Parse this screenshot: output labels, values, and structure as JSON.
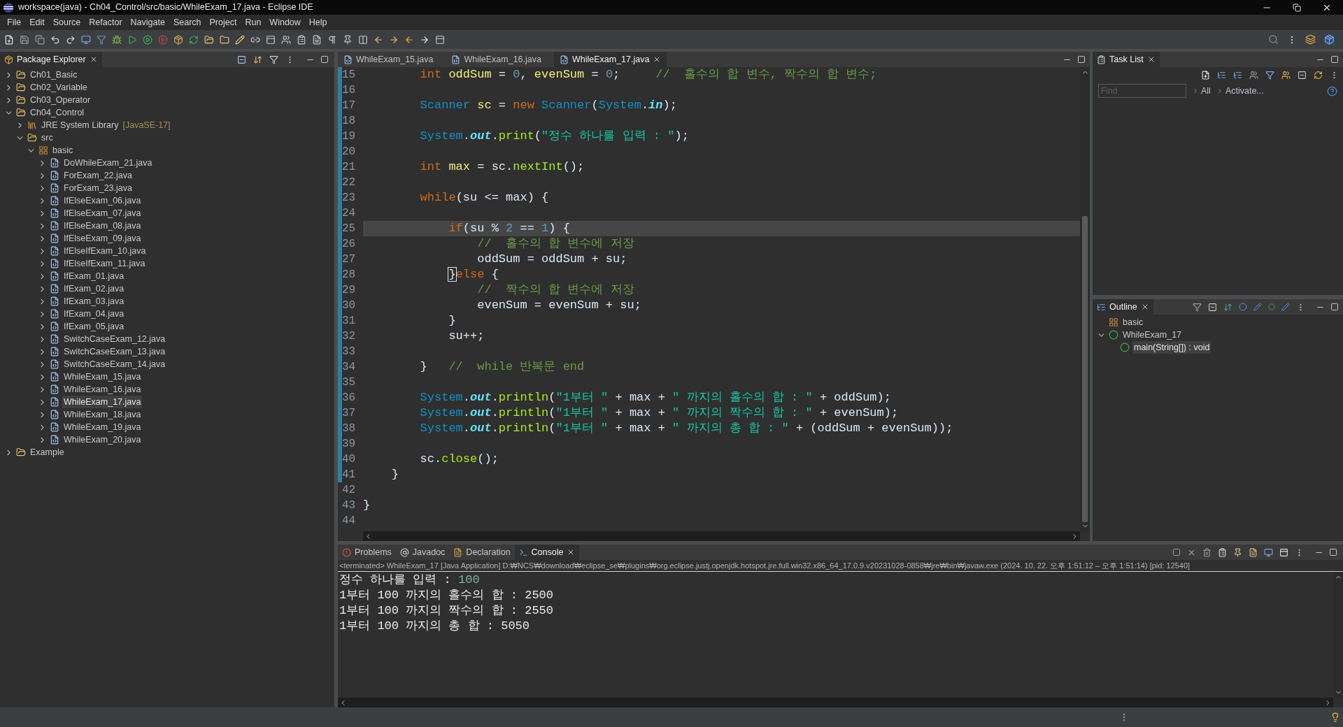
{
  "window": {
    "title": "workspace(java) - Ch04_Control/src/basic/WhileExam_17.java - Eclipse IDE"
  },
  "menu": [
    "File",
    "Edit",
    "Source",
    "Refactor",
    "Navigate",
    "Search",
    "Project",
    "Run",
    "Window",
    "Help"
  ],
  "explorer": {
    "title": "Package Explorer",
    "tree": [
      {
        "kind": "project",
        "label": "Ch01_Basic",
        "expanded": false,
        "selected": false
      },
      {
        "kind": "project",
        "label": "Ch02_Variable",
        "expanded": false,
        "selected": false
      },
      {
        "kind": "project",
        "label": "Ch03_Operator",
        "expanded": false,
        "selected": false
      },
      {
        "kind": "project",
        "label": "Ch04_Control",
        "expanded": true,
        "selected": false,
        "children": [
          {
            "kind": "library",
            "label": "JRE System Library",
            "decoration": "[JavaSE-17]",
            "expanded": false,
            "selected": false
          },
          {
            "kind": "folder",
            "label": "src",
            "expanded": true,
            "selected": false,
            "children": [
              {
                "kind": "package",
                "label": "basic",
                "expanded": true,
                "selected": false,
                "children": [
                  {
                    "kind": "file",
                    "label": "DoWhileExam_21.java",
                    "expanded": false,
                    "selected": false
                  },
                  {
                    "kind": "file",
                    "label": "ForExam_22.java",
                    "expanded": false,
                    "selected": false
                  },
                  {
                    "kind": "file",
                    "label": "ForExam_23.java",
                    "expanded": false,
                    "selected": false
                  },
                  {
                    "kind": "file",
                    "label": "IfElseExam_06.java",
                    "expanded": false,
                    "selected": false
                  },
                  {
                    "kind": "file",
                    "label": "IfElseExam_07.java",
                    "expanded": false,
                    "selected": false
                  },
                  {
                    "kind": "file",
                    "label": "IfElseExam_08.java",
                    "expanded": false,
                    "selected": false
                  },
                  {
                    "kind": "file",
                    "label": "IfElseExam_09.java",
                    "expanded": false,
                    "selected": false
                  },
                  {
                    "kind": "file",
                    "label": "IfElseIfExam_10.java",
                    "expanded": false,
                    "selected": false
                  },
                  {
                    "kind": "file",
                    "label": "IfElseIfExam_11.java",
                    "expanded": false,
                    "selected": false
                  },
                  {
                    "kind": "file",
                    "label": "IfExam_01.java",
                    "expanded": false,
                    "selected": false
                  },
                  {
                    "kind": "file",
                    "label": "IfExam_02.java",
                    "expanded": false,
                    "selected": false
                  },
                  {
                    "kind": "file",
                    "label": "IfExam_03.java",
                    "expanded": false,
                    "selected": false
                  },
                  {
                    "kind": "file",
                    "label": "IfExam_04.java",
                    "expanded": false,
                    "selected": false
                  },
                  {
                    "kind": "file",
                    "label": "IfExam_05.java",
                    "expanded": false,
                    "selected": false
                  },
                  {
                    "kind": "file",
                    "label": "SwitchCaseExam_12.java",
                    "expanded": false,
                    "selected": false
                  },
                  {
                    "kind": "file",
                    "label": "SwitchCaseExam_13.java",
                    "expanded": false,
                    "selected": false
                  },
                  {
                    "kind": "file",
                    "label": "SwitchCaseExam_14.java",
                    "expanded": false,
                    "selected": false
                  },
                  {
                    "kind": "file",
                    "label": "WhileExam_15.java",
                    "expanded": false,
                    "selected": false
                  },
                  {
                    "kind": "file",
                    "label": "WhileExam_16.java",
                    "expanded": false,
                    "selected": false
                  },
                  {
                    "kind": "file",
                    "label": "WhileExam_17.java",
                    "expanded": false,
                    "selected": true
                  },
                  {
                    "kind": "file",
                    "label": "WhileExam_18.java",
                    "expanded": false,
                    "selected": false
                  },
                  {
                    "kind": "file",
                    "label": "WhileExam_19.java",
                    "expanded": false,
                    "selected": false
                  },
                  {
                    "kind": "file",
                    "label": "WhileExam_20.java",
                    "expanded": false,
                    "selected": false
                  }
                ]
              }
            ]
          }
        ]
      },
      {
        "kind": "project",
        "label": "Example",
        "expanded": false,
        "selected": false
      }
    ]
  },
  "editor": {
    "tabs": [
      {
        "label": "WhileExam_15.java",
        "selected": false
      },
      {
        "label": "WhileExam_16.java",
        "selected": false
      },
      {
        "label": "WhileExam_17.java",
        "selected": true
      }
    ],
    "lines": [
      {
        "number": "15",
        "current": false,
        "changed": true,
        "tokens": [
          {
            "kind": "keyword",
            "text": "        int"
          },
          {
            "kind": "variable",
            "text": " oddSum"
          },
          {
            "kind": "plain",
            "text": " = "
          },
          {
            "kind": "number",
            "text": "0"
          },
          {
            "kind": "plain",
            "text": ", "
          },
          {
            "kind": "variable",
            "text": "evenSum"
          },
          {
            "kind": "plain",
            "text": " = "
          },
          {
            "kind": "number",
            "text": "0"
          },
          {
            "kind": "plain",
            "text": ";     "
          },
          {
            "kind": "comment",
            "text": "//  홀수의 합 변수, 짝수의 합 변수;"
          }
        ]
      },
      {
        "number": "16",
        "current": false,
        "changed": true
      },
      {
        "number": "17",
        "current": false,
        "changed": true,
        "tokens": [
          {
            "kind": "type",
            "text": "        Scanner"
          },
          {
            "kind": "variable",
            "text": " sc"
          },
          {
            "kind": "plain",
            "text": " = "
          },
          {
            "kind": "keyword",
            "text": "new"
          },
          {
            "kind": "type",
            "text": " Scanner"
          },
          {
            "kind": "plain",
            "text": "("
          },
          {
            "kind": "type",
            "text": "System"
          },
          {
            "kind": "plain",
            "text": "."
          },
          {
            "kind": "field",
            "text": "in"
          },
          {
            "kind": "plain",
            "text": ");"
          }
        ]
      },
      {
        "number": "18",
        "current": false,
        "changed": true
      },
      {
        "number": "19",
        "current": false,
        "changed": true,
        "tokens": [
          {
            "kind": "type",
            "text": "        System"
          },
          {
            "kind": "plain",
            "text": "."
          },
          {
            "kind": "field",
            "text": "out"
          },
          {
            "kind": "plain",
            "text": "."
          },
          {
            "kind": "method",
            "text": "print"
          },
          {
            "kind": "plain",
            "text": "("
          },
          {
            "kind": "string",
            "text": "\"정수 하나를 입력 : \""
          },
          {
            "kind": "plain",
            "text": ");"
          }
        ]
      },
      {
        "number": "20",
        "current": false,
        "changed": true
      },
      {
        "number": "21",
        "current": false,
        "changed": true,
        "tokens": [
          {
            "kind": "keyword",
            "text": "        int"
          },
          {
            "kind": "variable",
            "text": " max"
          },
          {
            "kind": "plain",
            "text": " = sc."
          },
          {
            "kind": "method",
            "text": "nextInt"
          },
          {
            "kind": "plain",
            "text": "();"
          }
        ]
      },
      {
        "number": "22",
        "current": false,
        "changed": true
      },
      {
        "number": "23",
        "current": false,
        "changed": true,
        "tokens": [
          {
            "kind": "keyword",
            "text": "        while"
          },
          {
            "kind": "plain",
            "text": "(su <= max) {"
          }
        ]
      },
      {
        "number": "24",
        "current": false,
        "changed": true
      },
      {
        "number": "25",
        "current": true,
        "changed": true,
        "tokens": [
          {
            "kind": "keyword",
            "text": "            if"
          },
          {
            "kind": "plain",
            "text": "(su % "
          },
          {
            "kind": "number",
            "text": "2"
          },
          {
            "kind": "plain",
            "text": " == "
          },
          {
            "kind": "number",
            "text": "1"
          },
          {
            "kind": "plain",
            "text": ") {"
          }
        ]
      },
      {
        "number": "26",
        "current": false,
        "changed": true,
        "tokens": [
          {
            "kind": "comment",
            "text": "                //  홀수의 합 변수에 저장"
          }
        ]
      },
      {
        "number": "27",
        "current": false,
        "changed": true,
        "tokens": [
          {
            "kind": "plain",
            "text": "                oddSum = oddSum + su;"
          }
        ]
      },
      {
        "number": "28",
        "current": false,
        "changed": true,
        "tokens": [
          {
            "kind": "bracket",
            "text": "            }"
          },
          {
            "kind": "keyword",
            "text": "else"
          },
          {
            "kind": "plain",
            "text": " {"
          }
        ]
      },
      {
        "number": "29",
        "current": false,
        "changed": true,
        "tokens": [
          {
            "kind": "comment",
            "text": "                //  짝수의 합 변수에 저장"
          }
        ]
      },
      {
        "number": "30",
        "current": false,
        "changed": true,
        "tokens": [
          {
            "kind": "plain",
            "text": "                evenSum = evenSum + su;"
          }
        ]
      },
      {
        "number": "31",
        "current": false,
        "changed": true,
        "tokens": [
          {
            "kind": "plain",
            "text": "            }"
          }
        ]
      },
      {
        "number": "32",
        "current": false,
        "changed": true,
        "tokens": [
          {
            "kind": "plain",
            "text": "            su++;"
          }
        ]
      },
      {
        "number": "33",
        "current": false,
        "changed": true
      },
      {
        "number": "34",
        "current": false,
        "changed": true,
        "tokens": [
          {
            "kind": "plain",
            "text": "        }   "
          },
          {
            "kind": "comment",
            "text": "//  while 반복문 end"
          }
        ]
      },
      {
        "number": "35",
        "current": false,
        "changed": true
      },
      {
        "number": "36",
        "current": false,
        "changed": true,
        "tokens": [
          {
            "kind": "type",
            "text": "        System"
          },
          {
            "kind": "plain",
            "text": "."
          },
          {
            "kind": "field",
            "text": "out"
          },
          {
            "kind": "plain",
            "text": "."
          },
          {
            "kind": "method",
            "text": "println"
          },
          {
            "kind": "plain",
            "text": "("
          },
          {
            "kind": "string",
            "text": "\"1부터 \""
          },
          {
            "kind": "plain",
            "text": " + max + "
          },
          {
            "kind": "string",
            "text": "\" 까지의 홀수의 합 : \""
          },
          {
            "kind": "plain",
            "text": " + oddSum);"
          }
        ]
      },
      {
        "number": "37",
        "current": false,
        "changed": true,
        "tokens": [
          {
            "kind": "type",
            "text": "        System"
          },
          {
            "kind": "plain",
            "text": "."
          },
          {
            "kind": "field",
            "text": "out"
          },
          {
            "kind": "plain",
            "text": "."
          },
          {
            "kind": "method",
            "text": "println"
          },
          {
            "kind": "plain",
            "text": "("
          },
          {
            "kind": "string",
            "text": "\"1부터 \""
          },
          {
            "kind": "plain",
            "text": " + max + "
          },
          {
            "kind": "string",
            "text": "\" 까지의 짝수의 합 : \""
          },
          {
            "kind": "plain",
            "text": " + evenSum);"
          }
        ]
      },
      {
        "number": "38",
        "current": false,
        "changed": true,
        "tokens": [
          {
            "kind": "type",
            "text": "        System"
          },
          {
            "kind": "plain",
            "text": "."
          },
          {
            "kind": "field",
            "text": "out"
          },
          {
            "kind": "plain",
            "text": "."
          },
          {
            "kind": "method",
            "text": "println"
          },
          {
            "kind": "plain",
            "text": "("
          },
          {
            "kind": "string",
            "text": "\"1부터 \""
          },
          {
            "kind": "plain",
            "text": " + max + "
          },
          {
            "kind": "string",
            "text": "\" 까지의 총 합 : \""
          },
          {
            "kind": "plain",
            "text": " + (oddSum + evenSum));"
          }
        ]
      },
      {
        "number": "39",
        "current": false,
        "changed": true
      },
      {
        "number": "40",
        "current": false,
        "changed": true,
        "tokens": [
          {
            "kind": "plain",
            "text": "        sc."
          },
          {
            "kind": "method",
            "text": "close"
          },
          {
            "kind": "plain",
            "text": "();"
          }
        ]
      },
      {
        "number": "41",
        "current": false,
        "changed": true,
        "tokens": [
          {
            "kind": "plain",
            "text": "    }"
          }
        ]
      },
      {
        "number": "42",
        "current": false,
        "changed": false
      },
      {
        "number": "43",
        "current": false,
        "changed": false,
        "tokens": [
          {
            "kind": "plain",
            "text": "}"
          }
        ]
      },
      {
        "number": "44",
        "current": false,
        "changed": false
      }
    ]
  },
  "console": {
    "tabs": [
      {
        "kind": "problems",
        "label": "Problems",
        "selected": false
      },
      {
        "kind": "javadoc",
        "label": "Javadoc",
        "selected": false
      },
      {
        "kind": "declaration",
        "label": "Declaration",
        "selected": false
      },
      {
        "kind": "console",
        "label": "Console",
        "selected": true
      }
    ],
    "header": "<terminated> WhileExam_17 [Java Application] D:₩NCS₩download₩eclipse_se₩plugins₩org.eclipse.justj.openjdk.hotspot.jre.full.win32.x86_64_17.0.9.v20231028-0858₩jre₩bin₩javaw.exe  (2024. 10. 22. 오후 1:51:12 – 오후 1:51:14) [pid: 12540]",
    "lines": [
      {
        "text": "정수 하나를 입력 : ",
        "input": "100"
      },
      {
        "text": "1부터 100 까지의 홀수의 합 : 2500"
      },
      {
        "text": "1부터 100 까지의 짝수의 합 : 2550"
      },
      {
        "text": "1부터 100 까지의 총 합 : 5050"
      }
    ]
  },
  "task_list": {
    "title": "Task List",
    "find": {
      "placeholder": "Find"
    },
    "links": [
      "All",
      "Activate..."
    ]
  },
  "outline": {
    "title": "Outline",
    "tree": [
      {
        "kind": "package",
        "label": "basic",
        "selected": false
      },
      {
        "kind": "class",
        "label": "WhileExam_17",
        "expanded": true,
        "selected": false,
        "children": [
          {
            "kind": "method",
            "label": "main(String[]) : void",
            "selected": true
          }
        ]
      }
    ]
  }
}
